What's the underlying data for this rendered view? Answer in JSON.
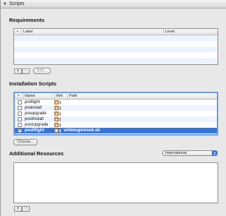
{
  "header": {
    "title": "Scripts",
    "disclosure_icon": "triangle-down-icon"
  },
  "requirements": {
    "title": "Requirements",
    "columns": [
      "Label",
      "Level"
    ],
    "add_label": "+",
    "remove_label": "−",
    "edit_label": "Edit..."
  },
  "installation": {
    "title": "Installation Scripts",
    "columns": [
      "Name",
      "Ref.",
      "Path"
    ],
    "rows": [
      {
        "name": "preflight",
        "ref": "A",
        "path": "",
        "checked": false
      },
      {
        "name": "preinstall",
        "ref": "A",
        "path": "",
        "checked": false
      },
      {
        "name": "preupgrade",
        "ref": "A",
        "path": "",
        "checked": false
      },
      {
        "name": "postinstall",
        "ref": "A",
        "path": "",
        "checked": false
      },
      {
        "name": "postupgrade",
        "ref": "A",
        "path": "",
        "checked": false
      },
      {
        "name": "postflight",
        "ref": "R",
        "path": "writeloginhook.sh",
        "checked": true
      }
    ],
    "choose_label": "Choose..."
  },
  "resources": {
    "title": "Additional Resources",
    "region": "International",
    "add_label": "+",
    "remove_label": "−"
  }
}
